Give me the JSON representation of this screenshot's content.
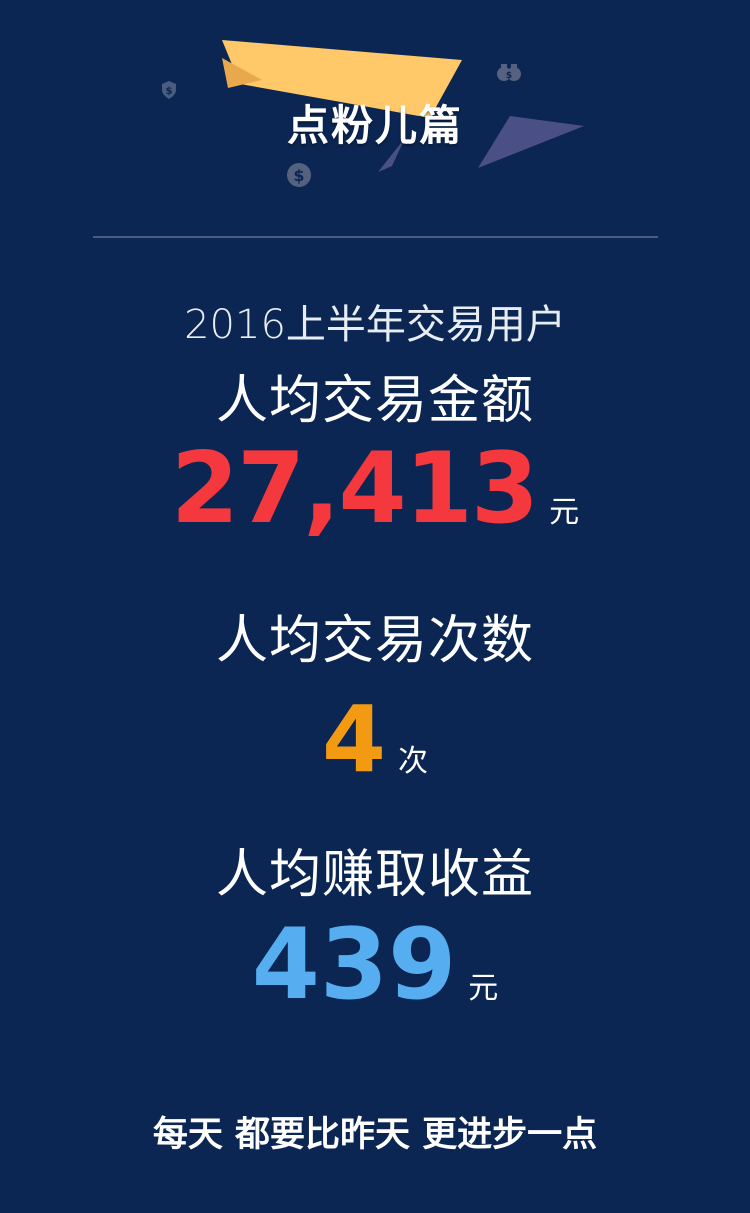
{
  "header": {
    "title": "点粉儿篇",
    "icons": [
      "shield-dollar-icon",
      "dollar-coin-icon",
      "money-bags-icon"
    ]
  },
  "subtitle": "2016上半年交易用户",
  "metrics": [
    {
      "label": "人均交易金额",
      "value": "27,413",
      "unit": "元",
      "color": "#f5383d"
    },
    {
      "label": "人均交易次数",
      "value": "4",
      "unit": "次",
      "color": "#f29b12"
    },
    {
      "label": "人均赚取收益",
      "value": "439",
      "unit": "元",
      "color": "#56aef0"
    }
  ],
  "footer": "每天 都要比昨天 更进步一点",
  "colors": {
    "background": "#0b2652",
    "banner_yellow": "#ffc869",
    "banner_purple": "#4a4f86"
  }
}
